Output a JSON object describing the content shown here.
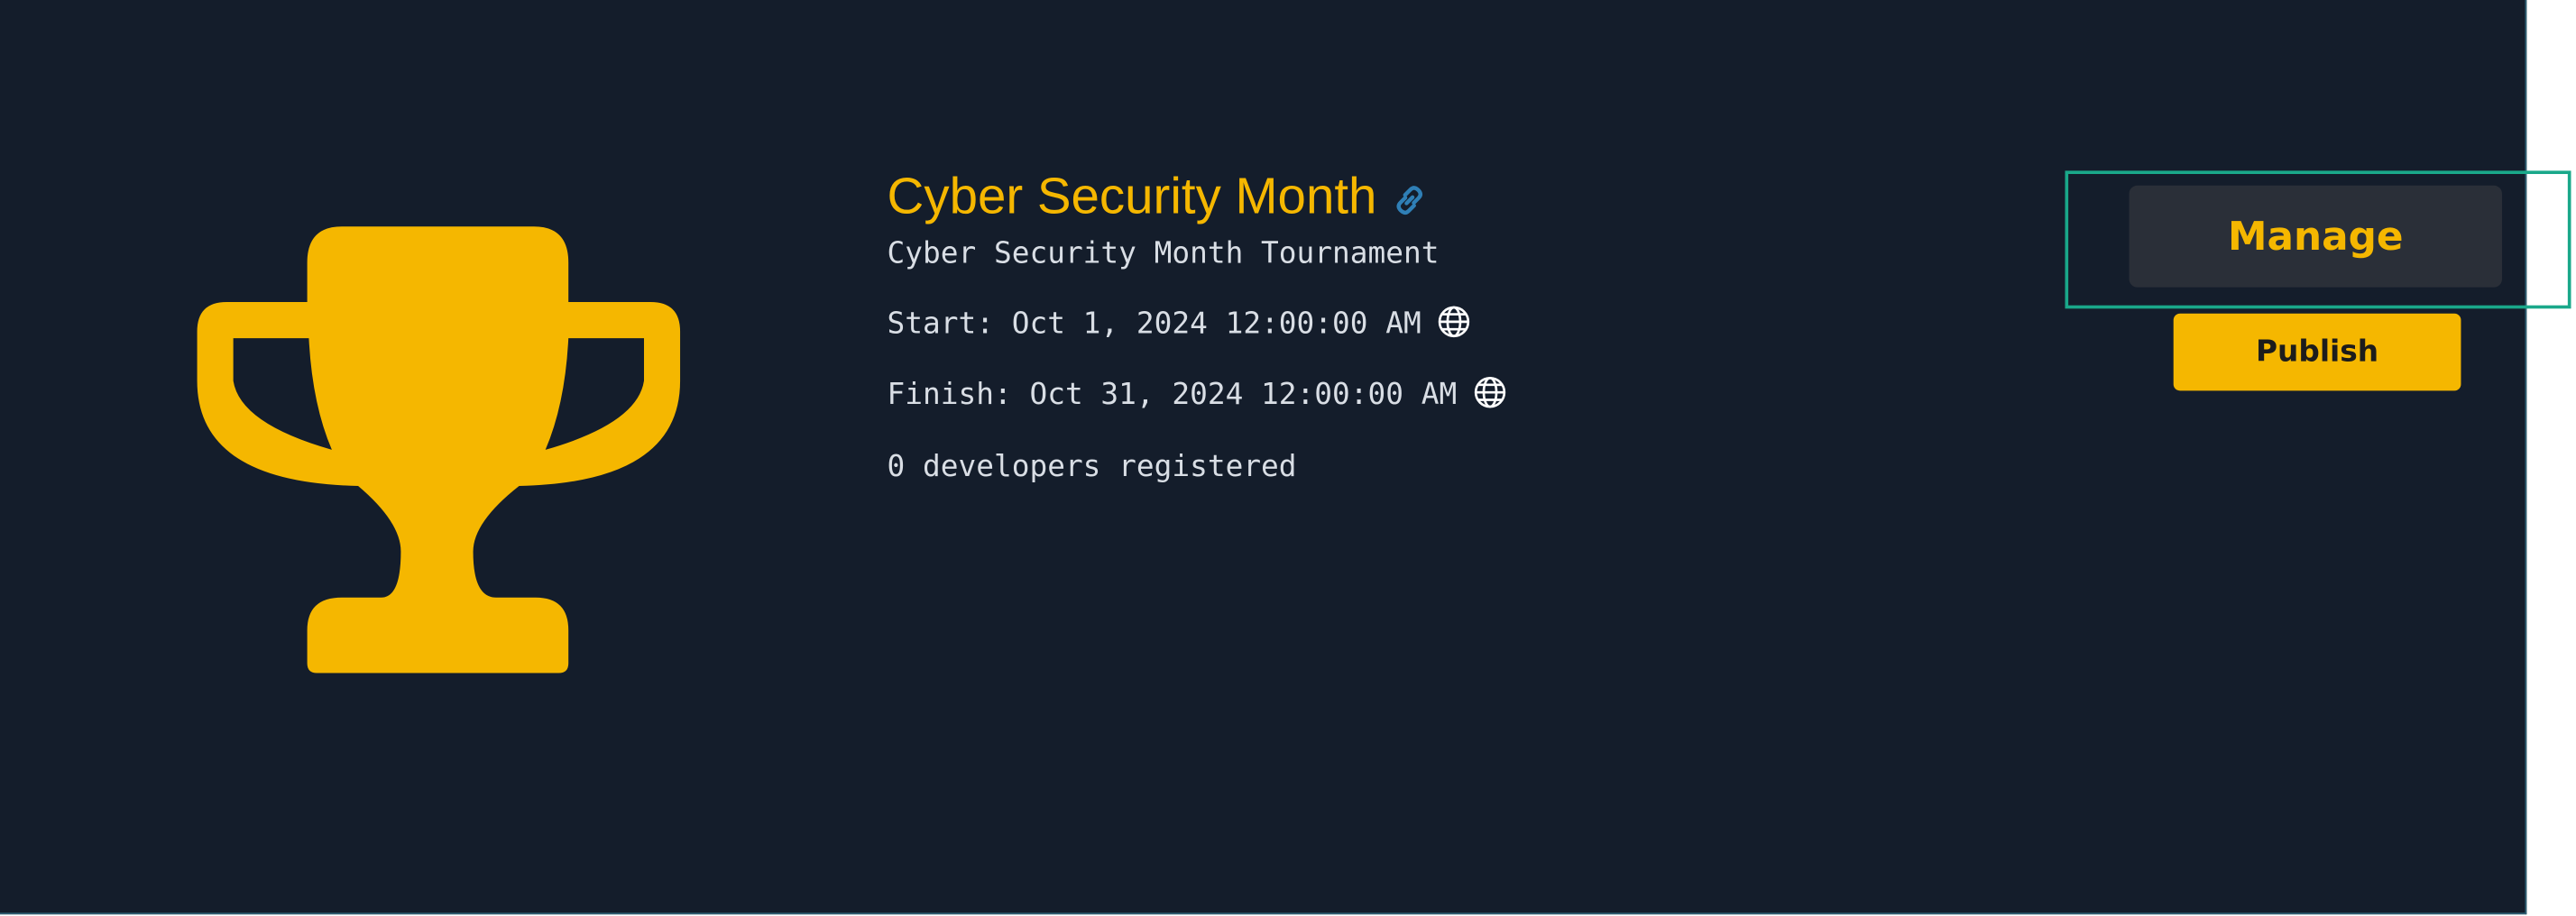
{
  "tournament": {
    "title": "Cyber Security Month",
    "subtitle": "Cyber Security Month Tournament",
    "start": "Start: Oct 1, 2024 12:00:00 AM",
    "finish": "Finish: Oct 31, 2024 12:00:00 AM",
    "registered": "0 developers registered"
  },
  "actions": {
    "manage_label": "Manage",
    "publish_label": "Publish"
  },
  "icons": {
    "trophy": "trophy-icon",
    "link": "link-icon",
    "timezone": "globe-icon"
  },
  "colors": {
    "background": "#141d2b",
    "accent": "#f5b700",
    "text": "#d9dee5",
    "link_icon": "#2f7fb6",
    "focus_outline": "#1aa88a",
    "manage_bg": "#2a2f38"
  }
}
